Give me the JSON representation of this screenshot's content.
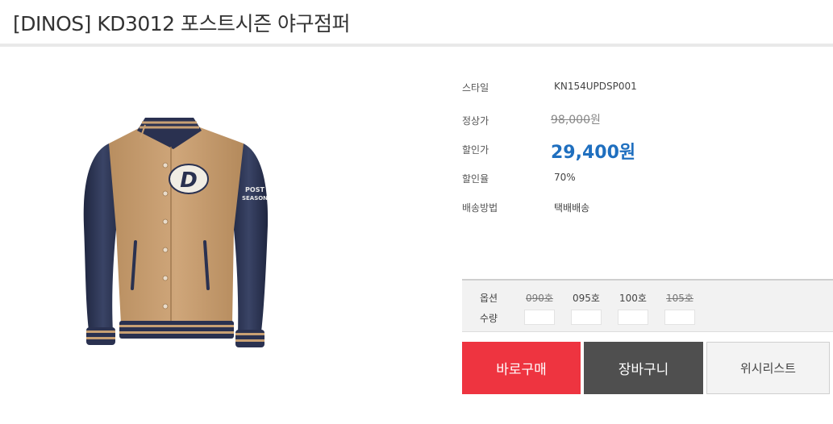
{
  "product": {
    "title": "[DINOS] KD3012 포스트시즌 야구점퍼"
  },
  "image": {
    "alt": "포스트시즌 야구점퍼",
    "logo_letter": "D",
    "sleeve_text_1": "POST",
    "sleeve_text_2": "SEASON"
  },
  "info": {
    "style_label": "스타일",
    "style_value": "KN154UPDSP001",
    "list_price_label": "정상가",
    "list_price": "98,000",
    "list_price_unit": "원",
    "sale_price_label": "할인가",
    "sale_price": "29,400원",
    "discount_label": "할인율",
    "discount_value": "70%",
    "shipping_label": "배송방법",
    "shipping_value": "택배배송"
  },
  "options": {
    "option_label": "옵션",
    "quantity_label": "수량",
    "sizes": [
      {
        "label": "090호",
        "sold_out": true
      },
      {
        "label": "095호",
        "sold_out": false
      },
      {
        "label": "100호",
        "sold_out": false
      },
      {
        "label": "105호",
        "sold_out": true
      }
    ]
  },
  "buttons": {
    "buy_now": "바로구매",
    "cart": "장바구니",
    "wishlist": "위시리스트"
  },
  "colors": {
    "buy_button": "#ee3440",
    "cart_button": "#4f4f4f",
    "sale_price": "#1f6fbf",
    "jacket_body": "#c8a073",
    "jacket_sleeve": "#2d3553"
  }
}
